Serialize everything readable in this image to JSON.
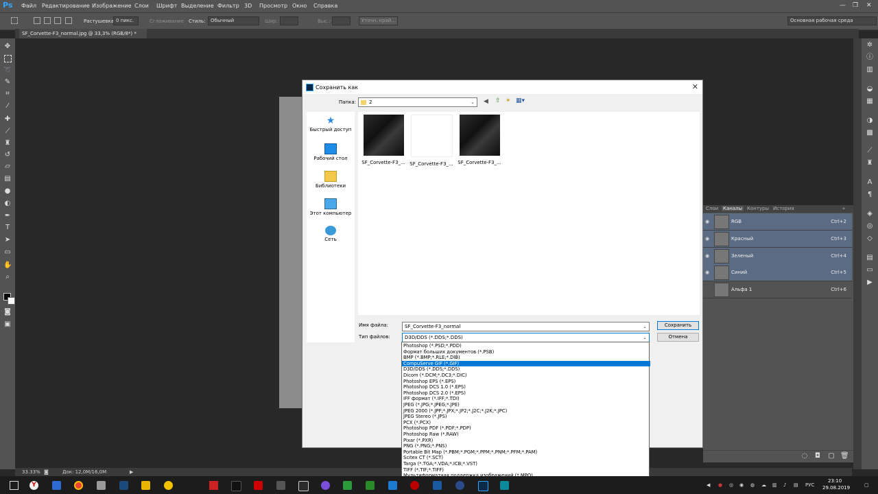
{
  "app": {
    "logo": "Ps",
    "accent": "#31a8ff"
  },
  "menu": [
    "Файл",
    "Редактирование",
    "Изображение",
    "Слои",
    "Шрифт",
    "Выделение",
    "Фильтр",
    "3D",
    "Просмотр",
    "Окно",
    "Справка"
  ],
  "window_controls": [
    "—",
    "❐",
    "✕"
  ],
  "options": {
    "feather_label": "Растушевка:",
    "feather_value": "0 пикс.",
    "antialias_label": "Сглаживание",
    "style_label": "Стиль:",
    "style_value": "Обычный",
    "width_label": "Шир.:",
    "height_label": "Выс.:",
    "refine_label": "Уточн. край...",
    "workspace": "Основная рабочая среда"
  },
  "document_tab": "SF_Corvette-F3_normal.jpg @ 33,3% (RGB/8*) *",
  "panel": {
    "tabs": [
      "Слои",
      "Каналы",
      "Контуры",
      "История"
    ],
    "active_tab": "Каналы",
    "channels": [
      {
        "name": "RGB",
        "key": "Ctrl+2"
      },
      {
        "name": "Красный",
        "key": "Ctrl+3"
      },
      {
        "name": "Зеленый",
        "key": "Ctrl+4"
      },
      {
        "name": "Синий",
        "key": "Ctrl+5"
      },
      {
        "name": "Альфа 1",
        "key": "Ctrl+6"
      }
    ]
  },
  "status": {
    "zoom": "33.33%",
    "doc": "Док: 12,0M/16,0M"
  },
  "dialog": {
    "title": "Сохранить как",
    "folder_label": "Папка:",
    "folder_value": "2",
    "places": [
      "Быстрый доступ",
      "Рабочий стол",
      "Библиотеки",
      "Этот компьютер",
      "Сеть"
    ],
    "files": [
      "SF_Corvette-F3_...",
      "SF_Corvette-F3_...",
      "SF_Corvette-F3_..."
    ],
    "filename_label": "Имя файла:",
    "filename_value": "SF_Corvette-F3_normal",
    "filetype_label": "Тип файлов:",
    "filetype_value": "D3D/DDS (*.DDS;*.DDS)",
    "save_button": "Сохранить",
    "cancel_button": "Отмена"
  },
  "filetype_options": [
    "Photoshop (*.PSD;*.PDD)",
    "Формат больших документов (*.PSB)",
    "BMP (*.BMP;*.RLE;*.DIB)",
    "CompuServe GIF (*.GIF)",
    "D3D/DDS (*.DDS;*.DDS)",
    "Dicom (*.DCM;*.DC3;*.DIC)",
    "Photoshop EPS (*.EPS)",
    "Photoshop DCS 1.0 (*.EPS)",
    "Photoshop DCS 2.0 (*.EPS)",
    "IFF формат (*.IFF;*.TDI)",
    "JPEG (*.JPG;*.JPEG;*.JPE)",
    "JPEG 2000 (*.JPF;*.JPX;*.JP2;*.J2C;*.J2K;*.JPC)",
    "JPEG Stereo (*.JPS)",
    "PCX (*.PCX)",
    "Photoshop PDF (*.PDF;*.PDP)",
    "Photoshop Raw (*.RAW)",
    "Pixar (*.PXR)",
    "PNG (*.PNG;*.PNS)",
    "Portable Bit Map (*.PBM;*.PGM;*.PPM;*.PNM;*.PFM;*.PAM)",
    "Scitex CT (*.SCT)",
    "Targa (*.TGA;*.VDA;*.ICB;*.VST)",
    "TIFF (*.TIF;*.TIFF)",
    "Мультиформатная поддержка изображений (*.MPO)"
  ],
  "highlighted_option": "CompuServe GIF (*.GIF)",
  "taskbar": {
    "lang": "РУС",
    "time": "23:10",
    "date": "29.08.2019"
  }
}
